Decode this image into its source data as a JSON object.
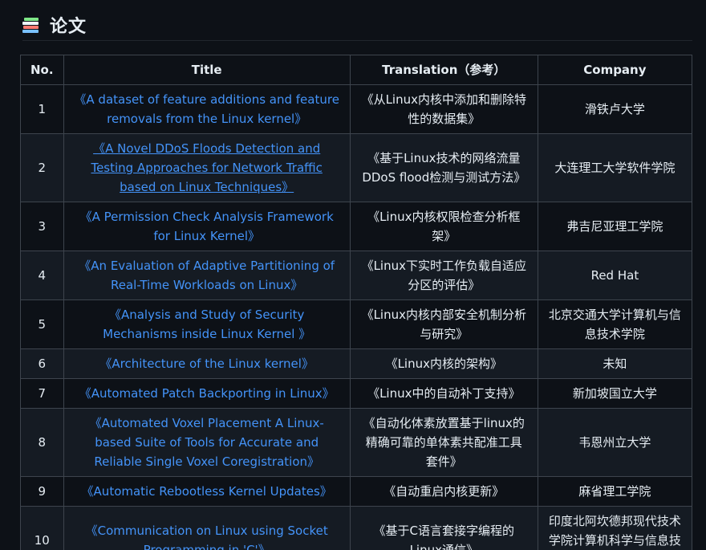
{
  "section": {
    "title": "论文",
    "icon": "books-icon"
  },
  "table": {
    "headers": {
      "no": "No.",
      "title": "Title",
      "translation": "Translation（参考）",
      "company": "Company"
    },
    "rows": [
      {
        "no": "1",
        "title": "《A dataset of feature additions and feature removals from the Linux kernel》",
        "translation": "《从Linux内核中添加和删除特性的数据集》",
        "company": "滑铁卢大学"
      },
      {
        "no": "2",
        "title": "《A Novel DDoS Floods Detection and Testing Approaches for Network Traffic based on Linux Techniques》",
        "translation": "《基于Linux技术的网络流量DDoS flood检测与测试方法》",
        "company": "大连理工大学软件学院"
      },
      {
        "no": "3",
        "title": "《A Permission Check Analysis Framework for Linux Kernel》",
        "translation": "《Linux内核权限检查分析框架》",
        "company": "弗吉尼亚理工学院"
      },
      {
        "no": "4",
        "title": "《An Evaluation of Adaptive Partitioning of Real-Time Workloads on Linux》",
        "translation": "《Linux下实时工作负载自适应分区的评估》",
        "company": "Red Hat"
      },
      {
        "no": "5",
        "title": "《Analysis and Study of Security Mechanisms inside Linux Kernel 》",
        "translation": "《Linux内核内部安全机制分析与研究》",
        "company": "北京交通大学计算机与信息技术学院"
      },
      {
        "no": "6",
        "title": "《Architecture of the Linux kernel》",
        "translation": "《Linux内核的架构》",
        "company": "未知"
      },
      {
        "no": "7",
        "title": "《Automated Patch Backporting in Linux》",
        "translation": "《Linux中的自动补丁支持》",
        "company": "新加坡国立大学"
      },
      {
        "no": "8",
        "title": "《Automated Voxel Placement A Linux-based Suite of Tools for Accurate and Reliable Single Voxel Coregistration》",
        "translation": "《自动化体素放置基于linux的精确可靠的单体素共配准工具套件》",
        "company": "韦恩州立大学"
      },
      {
        "no": "9",
        "title": "《Automatic Rebootless Kernel Updates》",
        "translation": "《自动重启内核更新》",
        "company": "麻省理工学院"
      },
      {
        "no": "10",
        "title": "《Communication on Linux using Socket Programming in 'C'》",
        "translation": "《基于C语言套接字编程的Linux通信》",
        "company": "印度北阿坎德邦现代技术学院计算机科学与信息技术学院"
      }
    ]
  }
}
